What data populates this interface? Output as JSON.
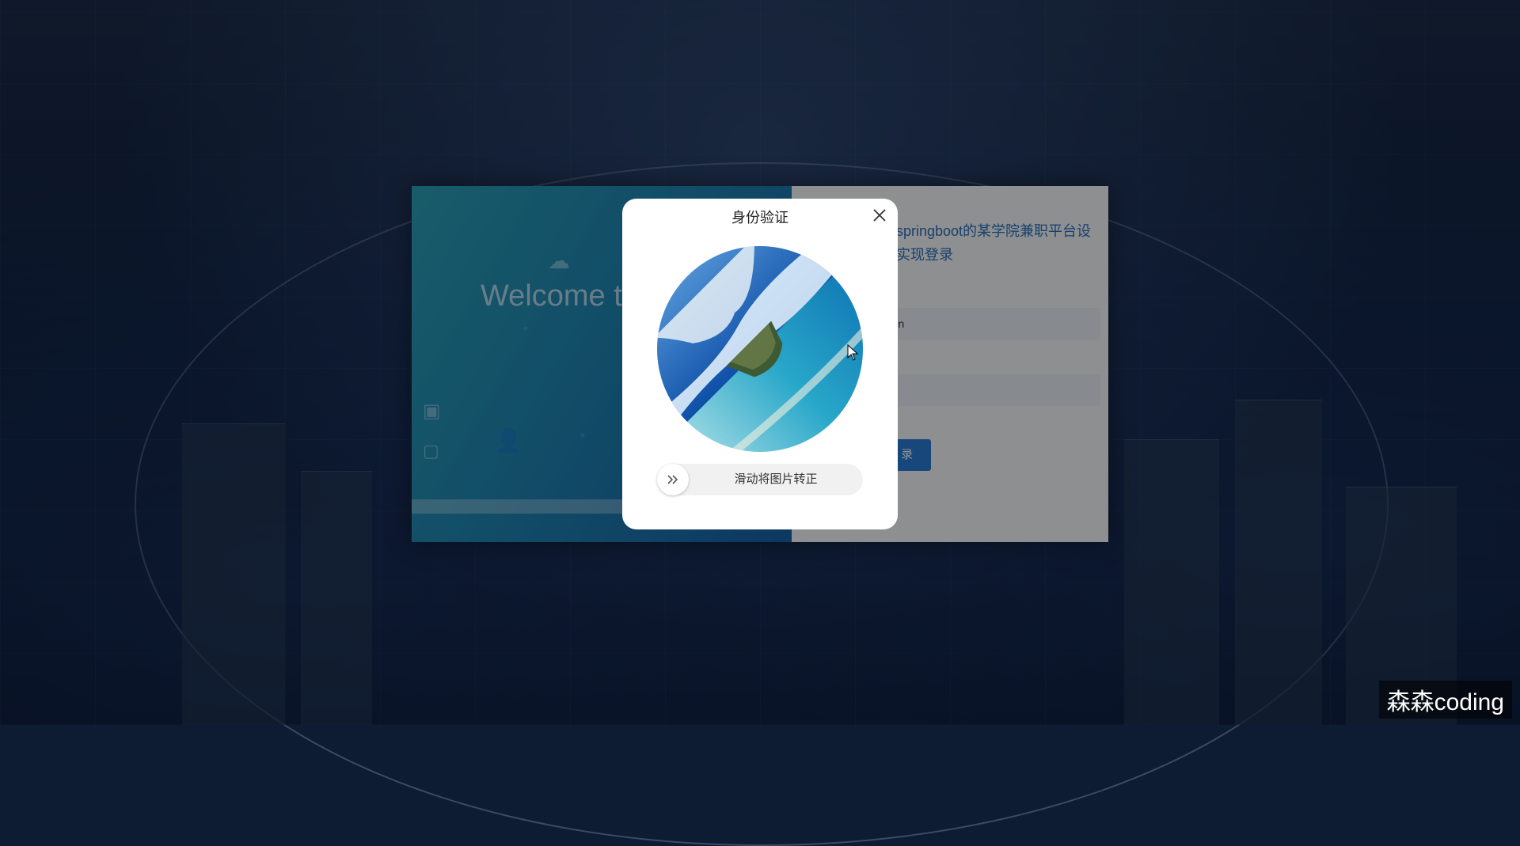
{
  "background": {
    "left_panel_welcome": "Welcome to",
    "system_title": "基于springboot的某学院兼职平台设计与实现登录",
    "username_value": "admin",
    "password_value": "",
    "login_button": "登 录"
  },
  "modal": {
    "title": "身份验证",
    "slider_hint": "滑动将图片转正",
    "captcha_rotation_deg": 135
  },
  "watermark": "森森coding",
  "colors": {
    "accent": "#2a7ad6",
    "overlay": "rgba(0,0,0,0.42)"
  }
}
